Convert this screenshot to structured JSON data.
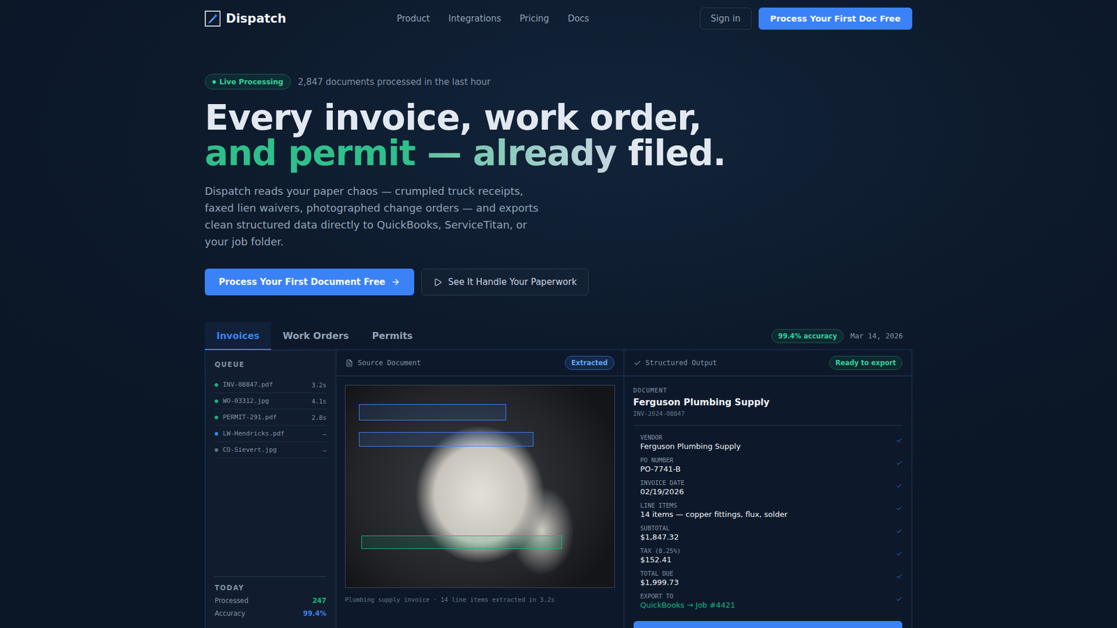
{
  "nav": {
    "brand": "Dispatch",
    "links": [
      "Product",
      "Integrations",
      "Pricing",
      "Docs"
    ],
    "sign_in": "Sign in",
    "cta": "Process Your First Doc Free"
  },
  "hero": {
    "badge": "Live Processing",
    "badge_note": "2,847 documents processed in the last hour",
    "headline_line1": "Every invoice, work order,",
    "headline_accent": "and permit",
    "headline_fade": "— already",
    "headline_end": "filed.",
    "subtitle": "Dispatch reads your paper chaos — crumpled truck receipts, faxed lien waivers, photographed change orders — and exports clean structured data directly to QuickBooks, ServiceTitan, or your job folder.",
    "primary_button": "Process Your First Document Free",
    "secondary_button": "See It Handle Your Paperwork"
  },
  "demo": {
    "tabs": [
      {
        "label": "Invoices",
        "selected": true
      },
      {
        "label": "Work Orders",
        "selected": false
      },
      {
        "label": "Permits",
        "selected": false
      }
    ],
    "accuracy_badge": "99.4% accuracy",
    "date": "Mar 14, 2026",
    "queue": {
      "title": "QUEUE",
      "items": [
        {
          "name": "INV-08847.pdf",
          "time": "3.2s",
          "color": "#10b981"
        },
        {
          "name": "WO-03312.jpg",
          "time": "4.1s",
          "color": "#10b981"
        },
        {
          "name": "PERMIT-291.pdf",
          "time": "2.8s",
          "color": "#10b981"
        },
        {
          "name": "LW-Hendricks.pdf",
          "time": "—",
          "color": "#3b82f6"
        },
        {
          "name": "CO-Sievert.jpg",
          "time": "—",
          "color": "#64748b"
        }
      ]
    },
    "today": {
      "title": "TODAY",
      "stats": [
        {
          "label": "Processed",
          "value": "247",
          "color": "#10b981"
        },
        {
          "label": "Accuracy",
          "value": "99.4%",
          "color": "#3b82f6"
        }
      ]
    },
    "source": {
      "title": "Source Document",
      "badge": "Extracted",
      "caption": "Plumbing supply invoice · 14 line items extracted in 3.2s",
      "highlights": [
        {
          "color": "#3b82f6"
        },
        {
          "color": "#3b82f6"
        },
        {
          "color": "#10b981"
        }
      ]
    },
    "output": {
      "title": "Structured Output",
      "badge": "Ready to export",
      "doc_label": "DOCUMENT",
      "doc_title": "Ferguson Plumbing Supply",
      "doc_id": "INV-2024-08847",
      "fields": [
        {
          "label": "VENDOR",
          "value": "Ferguson Plumbing Supply",
          "verified": true,
          "color": "#3b82f6",
          "kind": "text"
        },
        {
          "label": "PO NUMBER",
          "value": "PO-7741-B",
          "verified": true,
          "color": "#3b82f6",
          "kind": "text"
        },
        {
          "label": "INVOICE DATE",
          "value": "02/19/2026",
          "verified": true,
          "color": "#3b82f6",
          "kind": "text"
        },
        {
          "label": "LINE ITEMS",
          "value": "14 items — copper fittings, flux, solder",
          "verified": true,
          "color": "#3b82f6",
          "kind": "text"
        },
        {
          "label": "SUBTOTAL",
          "value": "$1,847.32",
          "verified": true,
          "color": "#3b82f6",
          "kind": "text"
        },
        {
          "label": "TAX (8.25%)",
          "value": "$152.41",
          "verified": true,
          "color": "#3b82f6",
          "kind": "text"
        },
        {
          "label": "TOTAL DUE",
          "value": "$1,999.73",
          "verified": true,
          "color": "#3b82f6",
          "kind": "text"
        },
        {
          "label": "EXPORT TO",
          "value": "QuickBooks → Job #4421",
          "verified": true,
          "color": "#10b981",
          "kind": "export"
        }
      ]
    }
  }
}
